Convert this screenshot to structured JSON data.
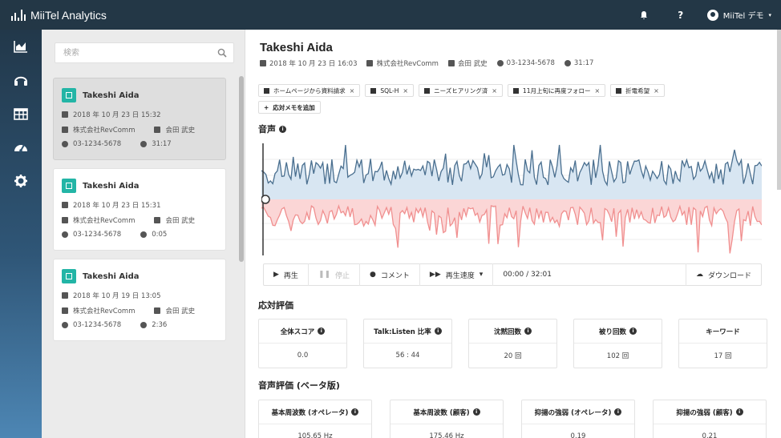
{
  "app": {
    "title": "MiiTel Analytics",
    "user_name": "MiiTel デモ"
  },
  "topbar": {
    "help_label": "?"
  },
  "search": {
    "placeholder": "検索"
  },
  "calls": [
    {
      "name": "Takeshi Aida",
      "datetime": "2018 年 10 月 23 日 15:32",
      "company": "株式会社RevComm",
      "operator": "会田 武史",
      "phone": "03-1234-5678",
      "duration": "31:17"
    },
    {
      "name": "Takeshi Aida",
      "datetime": "2018 年 10 月 23 日 15:31",
      "company": "株式会社RevComm",
      "operator": "会田 武史",
      "phone": "03-1234-5678",
      "duration": "0:05"
    },
    {
      "name": "Takeshi Aida",
      "datetime": "2018 年 10 月 19 日 13:05",
      "company": "株式会社RevComm",
      "operator": "会田 武史",
      "phone": "03-1234-5678",
      "duration": "2:36"
    }
  ],
  "detail": {
    "name": "Takeshi Aida",
    "datetime": "2018 年 10 月 23 日 16:03",
    "company": "株式会社RevComm",
    "operator": "会田 武史",
    "phone": "03-1234-5678",
    "duration": "31:17",
    "tags": [
      "ホームページから資料請求",
      "SQL-H",
      "ニーズヒアリング済",
      "11月上旬に再度フォロー",
      "折電希望"
    ],
    "add_memo": "応対メモを追加"
  },
  "audio": {
    "title": "音声",
    "play": "再生",
    "stop": "停止",
    "comment": "コメント",
    "speed": "再生速度",
    "time": "00:00 / 32:01",
    "download": "ダウンロード",
    "operator_color": "#4a6f8f",
    "customer_color": "#f08f8f"
  },
  "evaluation": {
    "title": "応対評価",
    "items": [
      {
        "label": "全体スコア",
        "value": "0.0"
      },
      {
        "label": "Talk:Listen 比率",
        "value": "56 : 44"
      },
      {
        "label": "沈黙回数",
        "value": "20 回"
      },
      {
        "label": "被り回数",
        "value": "102 回"
      },
      {
        "label": "キーワード",
        "value": "17 回"
      }
    ]
  },
  "voice_eval": {
    "title": "音声評価 (ベータ版)",
    "items": [
      {
        "label": "基本周波数 (オペレータ)",
        "value": "105.65 Hz"
      },
      {
        "label": "基本周波数 (顧客)",
        "value": "175.46 Hz"
      },
      {
        "label": "抑揚の強弱 (オペレータ)",
        "value": "0.19"
      },
      {
        "label": "抑揚の強弱 (顧客)",
        "value": "0.21"
      }
    ]
  },
  "accent_color": "#23b5a6"
}
